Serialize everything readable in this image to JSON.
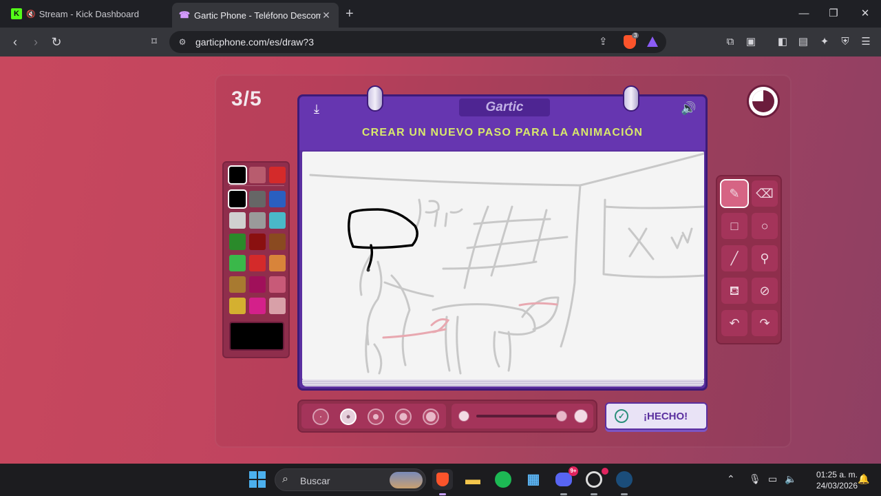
{
  "browser": {
    "tabs": [
      {
        "title": "Stream - Kick Dashboard",
        "favicon": "K",
        "muted": true,
        "active": false
      },
      {
        "title": "Gartic Phone - Teléfono Descomp",
        "favicon": "☎",
        "active": true
      }
    ],
    "url": "garticphone.com/es/draw?3",
    "shields_count": "3"
  },
  "game": {
    "round": "3/5",
    "brand": "Gartic",
    "instruction": "CREAR UN NUEVO PASO PARA LA ANIMACIÓN",
    "done_label": "¡HECHO!",
    "palette": {
      "top_row": [
        "#000000",
        "#b85c6e",
        "#d42a2a"
      ],
      "colors": [
        [
          "#000000",
          "#666666",
          "#2a5fc0"
        ],
        [
          "#d0d0d0",
          "#9a9a9a",
          "#4ab8c8"
        ],
        [
          "#2a8a2a",
          "#8a1010",
          "#8a4a20"
        ],
        [
          "#3ab84a",
          "#d42a2a",
          "#d8843a"
        ],
        [
          "#a87a30",
          "#a0105a",
          "#c85a78"
        ],
        [
          "#d4b030",
          "#d4208a",
          "#d8a0a8"
        ]
      ],
      "selected_color": "#000000"
    },
    "tools": [
      "pencil-icon",
      "eraser-icon",
      "rectangle-icon",
      "ellipse-icon",
      "line-icon",
      "eyedropper-icon",
      "fill-icon",
      "clear-icon",
      "undo-icon",
      "redo-icon"
    ],
    "brush_sizes": 5,
    "selected_brush_size": 2
  },
  "taskbar": {
    "search_placeholder": "Buscar",
    "discord_badge": "9+",
    "time": "01:25 a. m.",
    "date": "24/03/2026"
  },
  "colors": {
    "page_bg": "#c0445f",
    "board": "#6636b0",
    "instruction": "#d8e96b"
  }
}
